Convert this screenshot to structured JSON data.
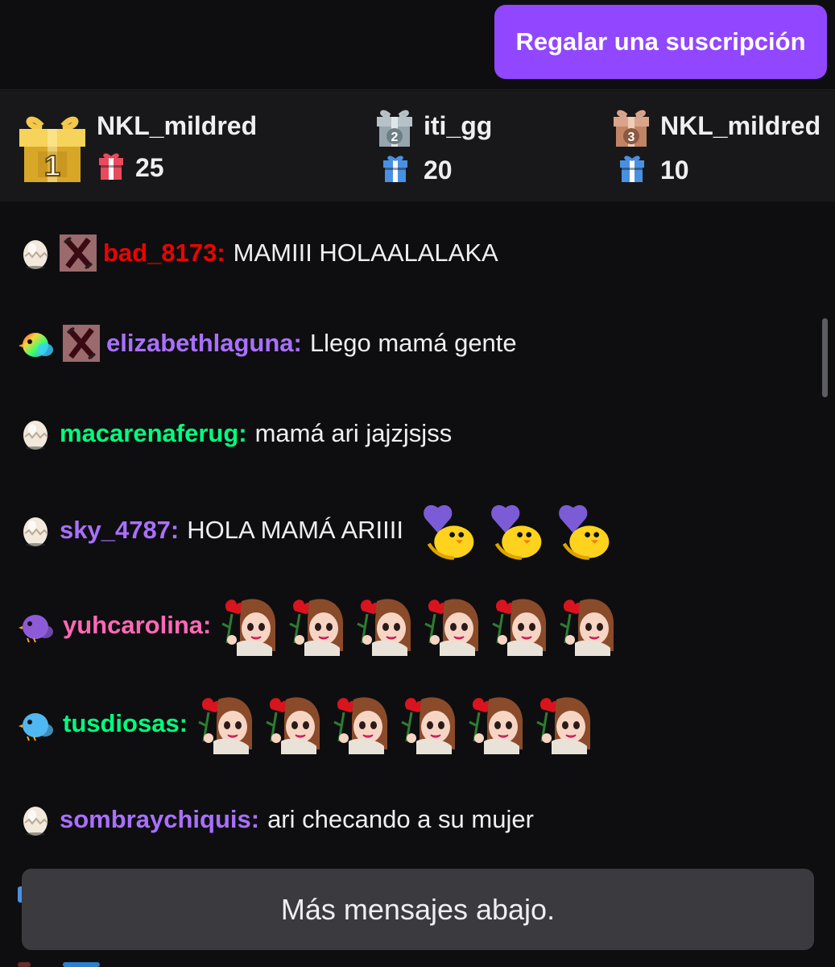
{
  "header": {
    "gift_sub_label": "Regalar una suscripción"
  },
  "leaderboard": [
    {
      "rank": "1",
      "name": "NKL_mildred",
      "count": "25"
    },
    {
      "rank": "2",
      "name": "iti_gg",
      "count": "20"
    },
    {
      "rank": "3",
      "name": "NKL_mildred",
      "count": "10"
    }
  ],
  "messages": [
    {
      "user": "bad_8173:",
      "text": "MAMIII HOLAALALAKA",
      "user_color": "#eb0400"
    },
    {
      "user": "elizabethlaguna:",
      "text": "Llego mamá gente",
      "user_color": "#a970ff"
    },
    {
      "user": "macarenaferug:",
      "text": "mamá ari jajzjsjss",
      "user_color": "#00ff7f"
    },
    {
      "user": "sky_4787:",
      "text": "HOLA MAMÁ ARIIII",
      "user_color": "#a970ff"
    },
    {
      "user": "yuhcarolina:",
      "text": "",
      "user_color": "#ff69b4"
    },
    {
      "user": "tusdiosas:",
      "text": "",
      "user_color": "#00ff7f"
    },
    {
      "user": "sombraychiquis:",
      "text": "ari checando a su mujer",
      "user_color": "#a970ff"
    }
  ],
  "footer": {
    "more_messages_label": "Más mensajes abajo."
  },
  "colors": {
    "accent": "#9147ff",
    "background": "#0e0e10",
    "panel": "#18181b"
  }
}
